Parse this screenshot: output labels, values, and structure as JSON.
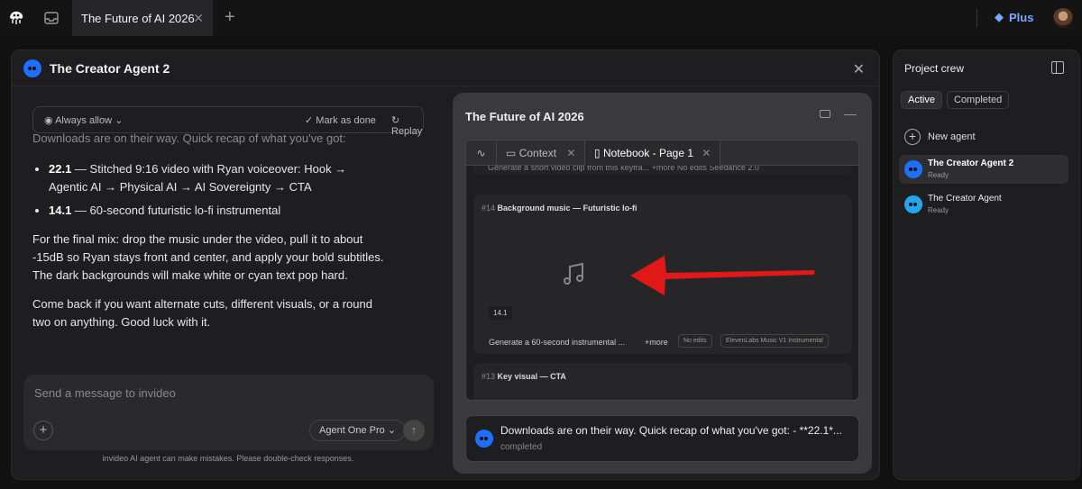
{
  "topbar": {
    "tab_title": "The Future of AI 2026",
    "plan_label": "Plus"
  },
  "main": {
    "title": "The Creator Agent 2",
    "toolbar": {
      "allow_label": "Always allow",
      "done_label": "Mark as done",
      "replay_label": "Replay"
    },
    "message": {
      "intro": "Downloads are on their way. Quick recap of what you've got:",
      "items": [
        {
          "bold": "22.1",
          "text": " — Stitched 9:16 video with Ryan voiceover: Hook → Agentic AI → Physical AI → AI Sovereignty → CTA"
        },
        {
          "bold": "14.1",
          "text": " — 60-second futuristic lo-fi instrumental"
        }
      ],
      "para1": "For the final mix: drop the music under the video, pull it to about -15dB so Ryan stays front and center, and apply your bold subtitles. The dark backgrounds will make white or cyan text pop hard.",
      "para2": "Come back if you want alternate cuts, different visuals, or a round two on anything. Good luck with it."
    },
    "composer": {
      "placeholder": "Send a message to invideo",
      "model": "Agent One Pro"
    },
    "disclaimer": "invideo AI agent can make mistakes. Please double-check responses."
  },
  "notebook": {
    "title": "The Future of AI 2026",
    "tabs": {
      "context": "Context",
      "notebook": "Notebook - Page 1"
    },
    "card_top_text": "Generate a short video clip from this keyfra...   +more   No edits   Seedance 2.0",
    "card": {
      "num": "#14",
      "title": "Background music — Futuristic lo-fi",
      "version": "14.1",
      "prompt": "Generate a 60-second instrumental ...",
      "more": "+more",
      "chip_edits": "No edits",
      "chip_model": "ElevenLabs Music V1 Instrumental"
    },
    "card2": {
      "num": "#13",
      "title": "Key visual — CTA"
    },
    "status": {
      "text": "Downloads are on their way. Quick recap of what you've got: - **22.1*...",
      "sub": "completed"
    }
  },
  "crew": {
    "title": "Project crew",
    "tabs": {
      "active": "Active",
      "completed": "Completed"
    },
    "new_agent": "New agent",
    "agents": [
      {
        "name": "The Creator Agent 2",
        "status": "Ready",
        "color": "#1f6fff"
      },
      {
        "name": "The Creator Agent",
        "status": "Ready",
        "color": "#1fa8f0"
      }
    ]
  },
  "colors": {
    "accent": "#7aa7ff",
    "arrow": "#e01818"
  }
}
